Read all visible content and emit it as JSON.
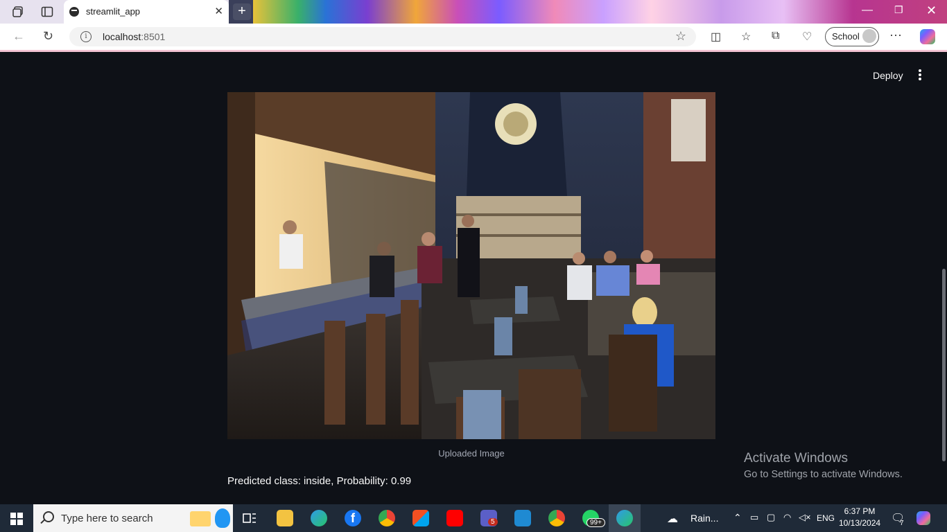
{
  "browser": {
    "tab_title": "streamlit_app",
    "tab_close": "✕",
    "new_tab": "+",
    "url_host": "localhost",
    "url_port": ":8501",
    "profile_label": "School",
    "more": "···"
  },
  "app": {
    "deploy_label": "Deploy",
    "image_caption": "Uploaded Image",
    "prediction_text": "Predicted class: inside, Probability: 0.99"
  },
  "watermark": {
    "line1": "Activate Windows",
    "line2": "Go to Settings to activate Windows."
  },
  "taskbar": {
    "search_placeholder": "Type here to search",
    "weather": "Rain...",
    "teams_badge": "5",
    "whatsapp_badge": "99+",
    "language": "ENG",
    "time": "6:37 PM",
    "date": "10/13/2024",
    "notification_count": "7"
  }
}
